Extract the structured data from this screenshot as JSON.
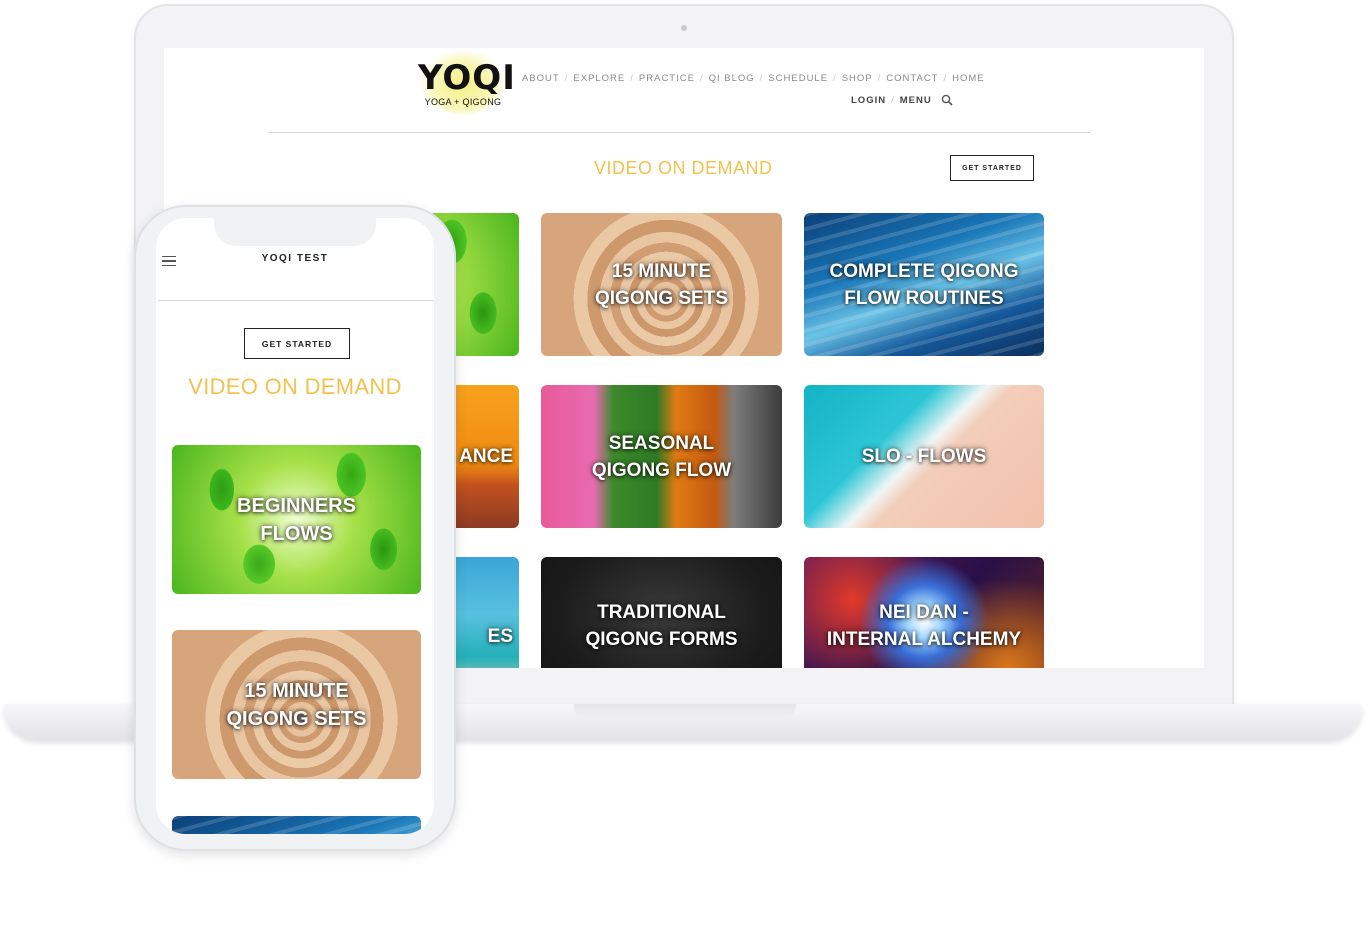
{
  "laptop": {
    "logo": {
      "word": "YOQI",
      "tagline": "YOGA + QIGONG"
    },
    "nav_primary": [
      "ABOUT",
      "EXPLORE",
      "PRACTICE",
      "QI BLOG",
      "SCHEDULE",
      "SHOP",
      "CONTACT",
      "HOME"
    ],
    "nav_secondary": {
      "login": "LOGIN",
      "menu": "MENU"
    },
    "page_title": "VIDEO ON DEMAND",
    "cta_label": "GET STARTED",
    "cards": [
      {
        "label": "",
        "image": "green-leaves"
      },
      {
        "label": "15 MINUTE\nQIGONG SETS",
        "image": "zen-sand-spiral"
      },
      {
        "label": "COMPLETE QIGONG\nFLOW ROUTINES",
        "image": "blue-water-flow"
      },
      {
        "label": "ANCE",
        "image": "orange-sunset-sea"
      },
      {
        "label": "SEASONAL\nQIGONG FLOW",
        "image": "four-seasons-trees"
      },
      {
        "label": "SLO - FLOWS",
        "image": "turquoise-beach"
      },
      {
        "label": "ES",
        "image": "tropical-beach"
      },
      {
        "label": "TRADITIONAL\nQIGONG FORMS",
        "image": "hands-practice"
      },
      {
        "label": "NEI DAN -\nINTERNAL ALCHEMY",
        "image": "cosmic-nebula"
      }
    ]
  },
  "phone": {
    "title": "YOQI TEST",
    "cta_label": "GET STARTED",
    "page_title": "VIDEO ON DEMAND",
    "cards": [
      {
        "label": "BEGINNERS\nFLOWS",
        "image": "green-leaves"
      },
      {
        "label": "15 MINUTE\nQIGONG SETS",
        "image": "zen-sand-spiral"
      },
      {
        "label": "",
        "image": "blue-water-flow"
      }
    ]
  },
  "colors": {
    "accent": "#f2c24f",
    "text": "#222222",
    "nav": "#8a8a8a"
  },
  "icons": [
    "search-icon",
    "hamburger-icon",
    "yin-yang-logo"
  ]
}
